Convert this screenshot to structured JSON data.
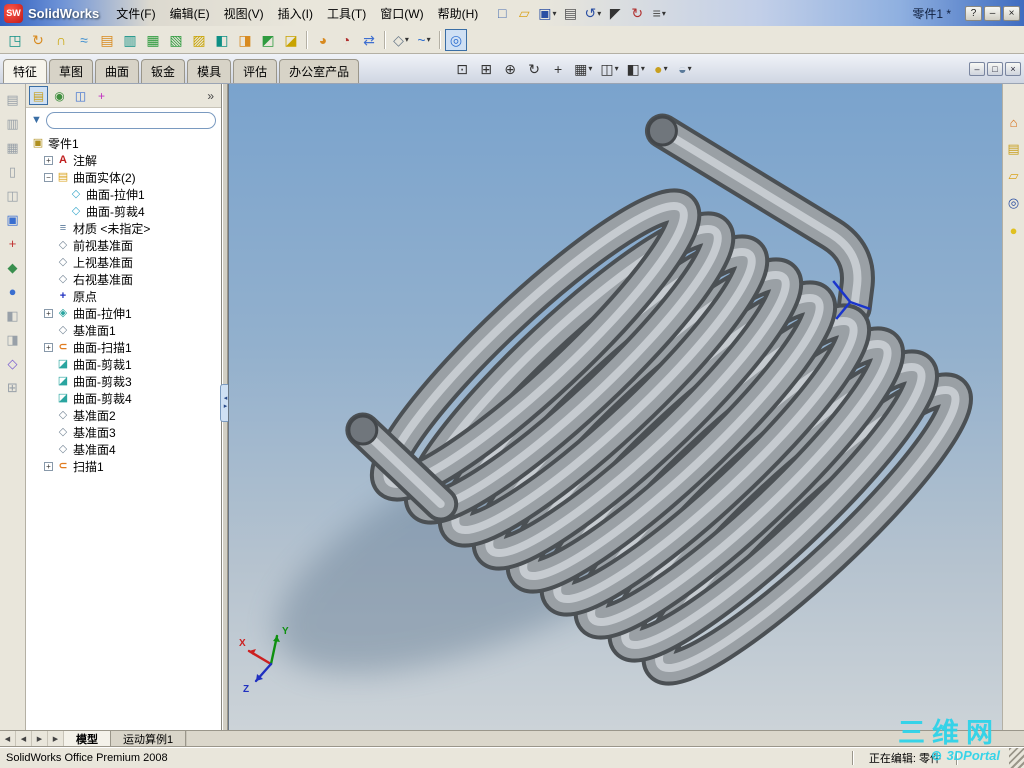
{
  "titlebar": {
    "logo": "SW",
    "app_name": "SolidWorks",
    "doc_title": "零件1 *",
    "menus": [
      "文件(F)",
      "编辑(E)",
      "视图(V)",
      "插入(I)",
      "工具(T)",
      "窗口(W)",
      "帮助(H)"
    ],
    "quick_icons": [
      {
        "name": "new-document-icon",
        "glyph": "□",
        "color": "#4a6fb0"
      },
      {
        "name": "open-icon",
        "glyph": "▱",
        "color": "#d9a21b"
      },
      {
        "name": "save-icon",
        "glyph": "▣",
        "color": "#2b4fa3",
        "caret": true
      },
      {
        "name": "print-icon",
        "glyph": "▤",
        "color": "#555555"
      },
      {
        "name": "undo-icon",
        "glyph": "↺",
        "color": "#2b4fa3",
        "caret": true
      },
      {
        "name": "select-icon",
        "glyph": "◤",
        "color": "#333333"
      },
      {
        "name": "rebuild-icon",
        "glyph": "↻",
        "color": "#b03030"
      },
      {
        "name": "options-icon",
        "glyph": "≡",
        "color": "#555555",
        "caret": true
      }
    ],
    "window_buttons": [
      {
        "name": "help-button",
        "glyph": "?"
      },
      {
        "name": "minimize-button",
        "glyph": "–"
      },
      {
        "name": "close-button",
        "glyph": "×"
      }
    ]
  },
  "feature_toolbar": {
    "icons": [
      {
        "name": "extruded-surface-icon",
        "glyph": "◳",
        "color": "#0e8f84"
      },
      {
        "name": "revolved-surface-icon",
        "glyph": "↻",
        "color": "#d88a1f"
      },
      {
        "name": "swept-surface-icon",
        "glyph": "∩",
        "color": "#c8a300"
      },
      {
        "name": "lofted-surface-icon",
        "glyph": "≈",
        "color": "#3f8fd0"
      },
      {
        "name": "boundary-surface-icon",
        "glyph": "▤",
        "color": "#d88a1f"
      },
      {
        "name": "offset-surface-icon",
        "glyph": "▥",
        "color": "#0e8f84"
      },
      {
        "name": "radiate-surface-icon",
        "glyph": "▦",
        "color": "#2f9b3f"
      },
      {
        "name": "knit-surface-icon",
        "glyph": "▧",
        "color": "#2f9b3f"
      },
      {
        "name": "planar-surface-icon",
        "glyph": "▨",
        "color": "#c8a300"
      },
      {
        "name": "extend-surface-icon",
        "glyph": "◧",
        "color": "#0e8f84"
      },
      {
        "name": "trim-surface-icon",
        "glyph": "◨",
        "color": "#d88a1f"
      },
      {
        "name": "fill-surface-icon",
        "glyph": "◩",
        "color": "#2f9b3f"
      },
      {
        "name": "untrim-surface-icon",
        "glyph": "◪",
        "color": "#c8a300"
      },
      {
        "sep": true
      },
      {
        "name": "fillet-icon",
        "glyph": "◕",
        "color": "#d88a1f"
      },
      {
        "name": "delete-face-icon",
        "glyph": "◔",
        "color": "#b03030"
      },
      {
        "name": "move-copy-icon",
        "glyph": "⇄",
        "color": "#3f6fd0"
      },
      {
        "sep": true
      },
      {
        "name": "reference-geometry-icon",
        "glyph": "◇",
        "color": "#6a7a8a",
        "caret": true
      },
      {
        "name": "curves-icon",
        "glyph": "~",
        "color": "#2f6fd0",
        "caret": true
      },
      {
        "sep": true
      },
      {
        "name": "instant3d-icon",
        "glyph": "◎",
        "color": "#2f6fd0",
        "pressed": true
      }
    ]
  },
  "tab_bar": {
    "tabs": [
      {
        "label": "特征",
        "active": true
      },
      {
        "label": "草图"
      },
      {
        "label": "曲面"
      },
      {
        "label": "钣金"
      },
      {
        "label": "模具"
      },
      {
        "label": "评估"
      },
      {
        "label": "办公室产品"
      }
    ],
    "window_controls": [
      {
        "name": "doc-minimize-button",
        "glyph": "–"
      },
      {
        "name": "doc-restore-button",
        "glyph": "□"
      },
      {
        "name": "doc-close-button",
        "glyph": "×"
      }
    ]
  },
  "viewport_toolbar": {
    "icons": [
      {
        "name": "zoom-fit-icon",
        "glyph": "⊡",
        "color": "#333333"
      },
      {
        "name": "zoom-area-icon",
        "glyph": "⊞",
        "color": "#333333"
      },
      {
        "name": "zoom-in-out-icon",
        "glyph": "⊕",
        "color": "#333333"
      },
      {
        "name": "rotate-view-icon",
        "glyph": "↻",
        "color": "#333333"
      },
      {
        "name": "pan-view-icon",
        "glyph": "+",
        "color": "#333333"
      },
      {
        "name": "standard-views-icon",
        "glyph": "▦",
        "color": "#333333",
        "caret": true
      },
      {
        "name": "display-style-icon",
        "glyph": "◫",
        "color": "#333333",
        "caret": true
      },
      {
        "name": "section-view-icon",
        "glyph": "◧",
        "color": "#333333",
        "caret": true
      },
      {
        "name": "appearances-icon",
        "glyph": "●",
        "color": "#c8a020",
        "caret": true
      },
      {
        "name": "scene-icon",
        "glyph": "◒",
        "color": "#5a7a9a",
        "caret": true
      }
    ]
  },
  "left_toolbar": {
    "icons": [
      {
        "name": "selection-filter-icon",
        "glyph": "▤",
        "color": "#98a0a8"
      },
      {
        "name": "document-properties-icon",
        "glyph": "▥",
        "color": "#98a0a8"
      },
      {
        "name": "layer-icon",
        "glyph": "▦",
        "color": "#98a0a8"
      },
      {
        "name": "sheet-icon",
        "glyph": "▯",
        "color": "#98a0a8"
      },
      {
        "name": "display-pane-icon",
        "glyph": "◫",
        "color": "#98a0a8"
      },
      {
        "name": "edit-appearance-icon",
        "glyph": "▣",
        "color": "#3a6fd0"
      },
      {
        "name": "add-relation-icon",
        "glyph": "+",
        "color": "#c03030"
      },
      {
        "name": "feature-statistics-icon",
        "glyph": "◆",
        "color": "#3a8f4f"
      },
      {
        "name": "texture-icon",
        "glyph": "●",
        "color": "#3a6fd0"
      },
      {
        "name": "section-icon",
        "glyph": "◧",
        "color": "#98a0a8"
      },
      {
        "name": "compare-icon",
        "glyph": "◨",
        "color": "#98a0a8"
      },
      {
        "name": "reference-icon",
        "glyph": "◇",
        "color": "#7a5fd0"
      },
      {
        "name": "grid-icon",
        "glyph": "⊞",
        "color": "#98a0a8"
      }
    ]
  },
  "feature_panel": {
    "header_icons": [
      {
        "name": "featuremanager-tab-icon",
        "glyph": "▤",
        "color": "#c8a020",
        "pressed": true
      },
      {
        "name": "propertymanager-tab-icon",
        "glyph": "◉",
        "color": "#3f8f3f"
      },
      {
        "name": "configurationmanager-tab-icon",
        "glyph": "◫",
        "color": "#3a6fd0"
      },
      {
        "name": "dimxpertmanager-tab-icon",
        "glyph": "+",
        "color": "#c030c0"
      }
    ],
    "chevron": "»",
    "tree": {
      "root": "零件1",
      "root_icon": "▣",
      "root_color": "#b09020",
      "items": [
        {
          "label": "注解",
          "icon": "annotations-icon",
          "glyph": "A",
          "color": "#c02020",
          "indent": 1,
          "expander": "+"
        },
        {
          "label": "曲面实体(2)",
          "icon": "surface-bodies-folder-icon",
          "glyph": "▤",
          "color": "#d9a21b",
          "indent": 1,
          "expander": "−"
        },
        {
          "label": "曲面-拉伸1",
          "icon": "surface-body-icon",
          "glyph": "◇",
          "color": "#3aa8cc",
          "indent": 2
        },
        {
          "label": "曲面-剪裁4",
          "icon": "surface-body-icon",
          "glyph": "◇",
          "color": "#3aa8cc",
          "indent": 2
        },
        {
          "label": "材质 <未指定>",
          "icon": "material-icon",
          "glyph": "≡",
          "color": "#5a7a9a",
          "indent": 1
        },
        {
          "label": "前视基准面",
          "icon": "plane-icon",
          "glyph": "◇",
          "color": "#7a8a9a",
          "indent": 1
        },
        {
          "label": "上视基准面",
          "icon": "plane-icon",
          "glyph": "◇",
          "color": "#7a8a9a",
          "indent": 1
        },
        {
          "label": "右视基准面",
          "icon": "plane-icon",
          "glyph": "◇",
          "color": "#7a8a9a",
          "indent": 1
        },
        {
          "label": "原点",
          "icon": "origin-icon",
          "glyph": "+",
          "color": "#2030c0",
          "indent": 1
        },
        {
          "label": "曲面-拉伸1",
          "icon": "surface-extrude-icon",
          "glyph": "◈",
          "color": "#2aa5a0",
          "indent": 1,
          "expander": "+"
        },
        {
          "label": "基准面1",
          "icon": "plane-icon",
          "glyph": "◇",
          "color": "#7a8a9a",
          "indent": 1
        },
        {
          "label": "曲面-扫描1",
          "icon": "surface-sweep-icon",
          "glyph": "⊂",
          "color": "#e07b1f",
          "indent": 1,
          "expander": "+"
        },
        {
          "label": "曲面-剪裁1",
          "icon": "surface-trim-icon",
          "glyph": "◪",
          "color": "#2aa5a0",
          "indent": 1
        },
        {
          "label": "曲面-剪裁3",
          "icon": "surface-trim-icon",
          "glyph": "◪",
          "color": "#2aa5a0",
          "indent": 1
        },
        {
          "label": "曲面-剪裁4",
          "icon": "surface-trim-icon",
          "glyph": "◪",
          "color": "#2aa5a0",
          "indent": 1
        },
        {
          "label": "基准面2",
          "icon": "plane-icon",
          "glyph": "◇",
          "color": "#7a8a9a",
          "indent": 1
        },
        {
          "label": "基准面3",
          "icon": "plane-icon",
          "glyph": "◇",
          "color": "#7a8a9a",
          "indent": 1
        },
        {
          "label": "基准面4",
          "icon": "plane-icon",
          "glyph": "◇",
          "color": "#7a8a9a",
          "indent": 1
        },
        {
          "label": "扫描1",
          "icon": "sweep-icon",
          "glyph": "⊂",
          "color": "#e07b1f",
          "indent": 1,
          "expander": "+"
        }
      ]
    }
  },
  "task_pane": {
    "icons": [
      {
        "name": "solidworks-resources-icon",
        "glyph": "⌂",
        "color": "#d86a10"
      },
      {
        "name": "design-library-icon",
        "glyph": "▤",
        "color": "#c8a020"
      },
      {
        "name": "file-explorer-icon",
        "glyph": "▱",
        "color": "#d9a21b"
      },
      {
        "name": "search-results-icon",
        "glyph": "◎",
        "color": "#2b4fa3"
      },
      {
        "name": "view-palette-icon",
        "glyph": "●",
        "color": "#e0c020"
      }
    ]
  },
  "bottom_bar": {
    "nav_icons": [
      {
        "name": "scroll-first-button",
        "glyph": "◀"
      },
      {
        "name": "scroll-prev-button",
        "glyph": "◀"
      },
      {
        "name": "scroll-next-button",
        "glyph": "▶"
      },
      {
        "name": "scroll-last-button",
        "glyph": "▶"
      }
    ],
    "doc_tabs": [
      {
        "label": "模型",
        "active": true
      },
      {
        "label": "运动算例1",
        "active": false
      }
    ]
  },
  "status_bar": {
    "left": "SolidWorks Office Premium 2008",
    "editing": "正在编辑: 零件"
  },
  "viewport": {
    "triad": {
      "x": "X",
      "y": "Y",
      "z": "Z"
    },
    "watermark": {
      "line1": "三维网",
      "logo": "⊕",
      "line2": "3DPortal"
    },
    "model_color": "#9aa0a5",
    "background_top": "#7aa3cd",
    "background_bottom": "#ccd3d8"
  }
}
